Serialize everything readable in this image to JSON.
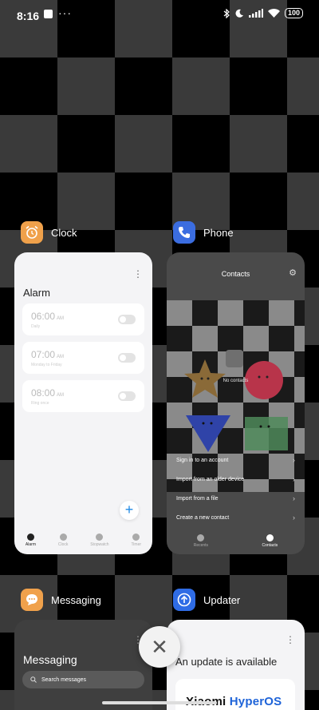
{
  "status_bar": {
    "time": "8:16",
    "dots": "···",
    "battery": "100",
    "icons": [
      "bluetooth-icon",
      "moon-icon",
      "signal-icon",
      "wifi-icon",
      "battery-icon"
    ]
  },
  "apps": {
    "clock": {
      "name": "Clock",
      "icon": "alarm-clock-icon",
      "icon_color": "#F0A14B",
      "title": "Alarm",
      "menu": "⋮",
      "alarms": [
        {
          "time": "06:00",
          "ampm": "AM",
          "sub": "Daily"
        },
        {
          "time": "07:00",
          "ampm": "AM",
          "sub": "Monday to Friday"
        },
        {
          "time": "08:00",
          "ampm": "AM",
          "sub": "Ring once"
        }
      ],
      "fab": "+",
      "nav": [
        "Alarm",
        "Clock",
        "Stopwatch",
        "Timer"
      ]
    },
    "phone": {
      "name": "Phone",
      "icon": "phone-icon",
      "icon_color": "#3B6DE0",
      "title": "Contacts",
      "gear": "⚙",
      "no_contacts": "No contacts",
      "actions": [
        "Sign in to an account",
        "Import from an older device",
        "Import from a file",
        "Create a new contact"
      ],
      "nav": [
        "Recents",
        "Contacts"
      ]
    },
    "messaging": {
      "name": "Messaging",
      "icon": "chat-bubble-icon",
      "icon_color": "#F0A14B",
      "title": "Messaging",
      "menu": "⋮",
      "search_placeholder": "Search messages"
    },
    "updater": {
      "name": "Updater",
      "icon": "update-arrow-icon",
      "icon_color": "#2F6CE5",
      "title": "An update is available",
      "menu": "⋮",
      "brand_word": "Xiaomi",
      "brand_os": "HyperOS"
    }
  },
  "close_symbol": "✕"
}
